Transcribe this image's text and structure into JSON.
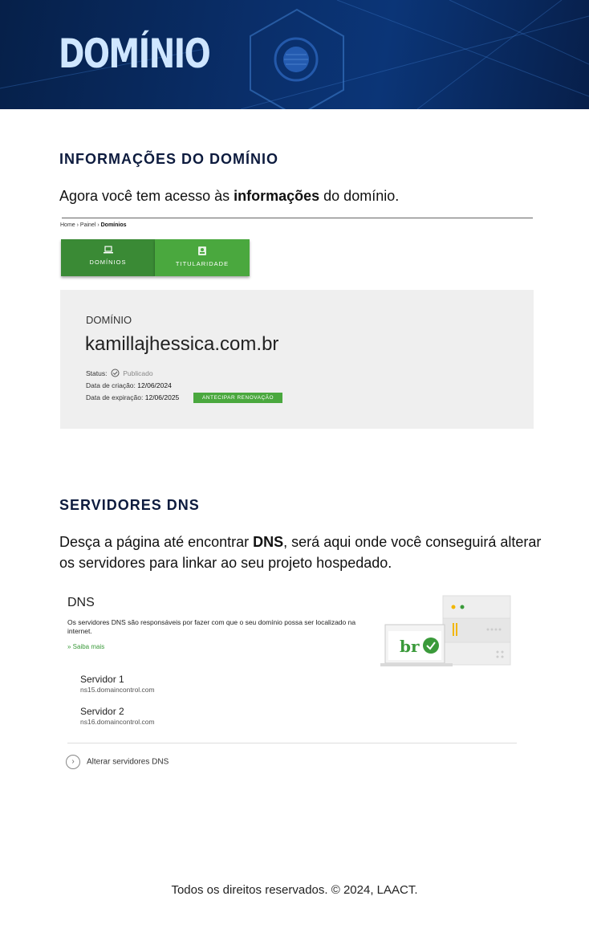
{
  "banner": {
    "title": "DOMÍNIO"
  },
  "section1": {
    "title": "INFORMAÇÕES DO DOMÍNIO",
    "text_before": "Agora você tem acesso às ",
    "text_bold": "informações",
    "text_after": " do domínio."
  },
  "screenshot1": {
    "breadcrumb": {
      "home": "Home",
      "sep1": " › ",
      "panel": "Painel",
      "sep2": " › ",
      "current": "Domínios"
    },
    "tabs": [
      {
        "label": "DOMÍNIOS"
      },
      {
        "label": "TITULARIDADE"
      }
    ],
    "card": {
      "label": "DOMÍNIO",
      "domain": "kamillajhessica.com.br",
      "status_label": "Status:",
      "status_value": "Publicado",
      "created_label": "Data de criação:",
      "created_value": "12/06/2024",
      "expires_label": "Data de expiração:",
      "expires_value": "12/06/2025",
      "renew_button": "ANTECIPAR RENOVAÇÃO"
    }
  },
  "section2": {
    "title": "SERVIDORES DNS",
    "line1_before": "Desça a página até encontrar ",
    "line1_bold": "DNS",
    "line1_after": ", será aqui onde você conseguirá alterar",
    "line2": "os servidores  para linkar ao seu projeto hospedado."
  },
  "screenshot2": {
    "title": "DNS",
    "description": "Os servidores DNS são responsáveis por fazer com que o seu domínio possa ser localizado na internet.",
    "learn_more": "» Saiba mais",
    "servers": [
      {
        "name": "Servidor 1",
        "host": "ns15.domaincontrol.com"
      },
      {
        "name": "Servidor 2",
        "host": "ns16.domaincontrol.com"
      }
    ],
    "change_link": "Alterar servidores DNS",
    "illustration_text": "br"
  },
  "footer": {
    "text": "Todos os direitos reservados. © 2024, LAACT."
  },
  "colors": {
    "banner": "#0a2f6b",
    "heading": "#0d1b3e",
    "green_dark": "#3a8a35",
    "green": "#4aa83e"
  }
}
